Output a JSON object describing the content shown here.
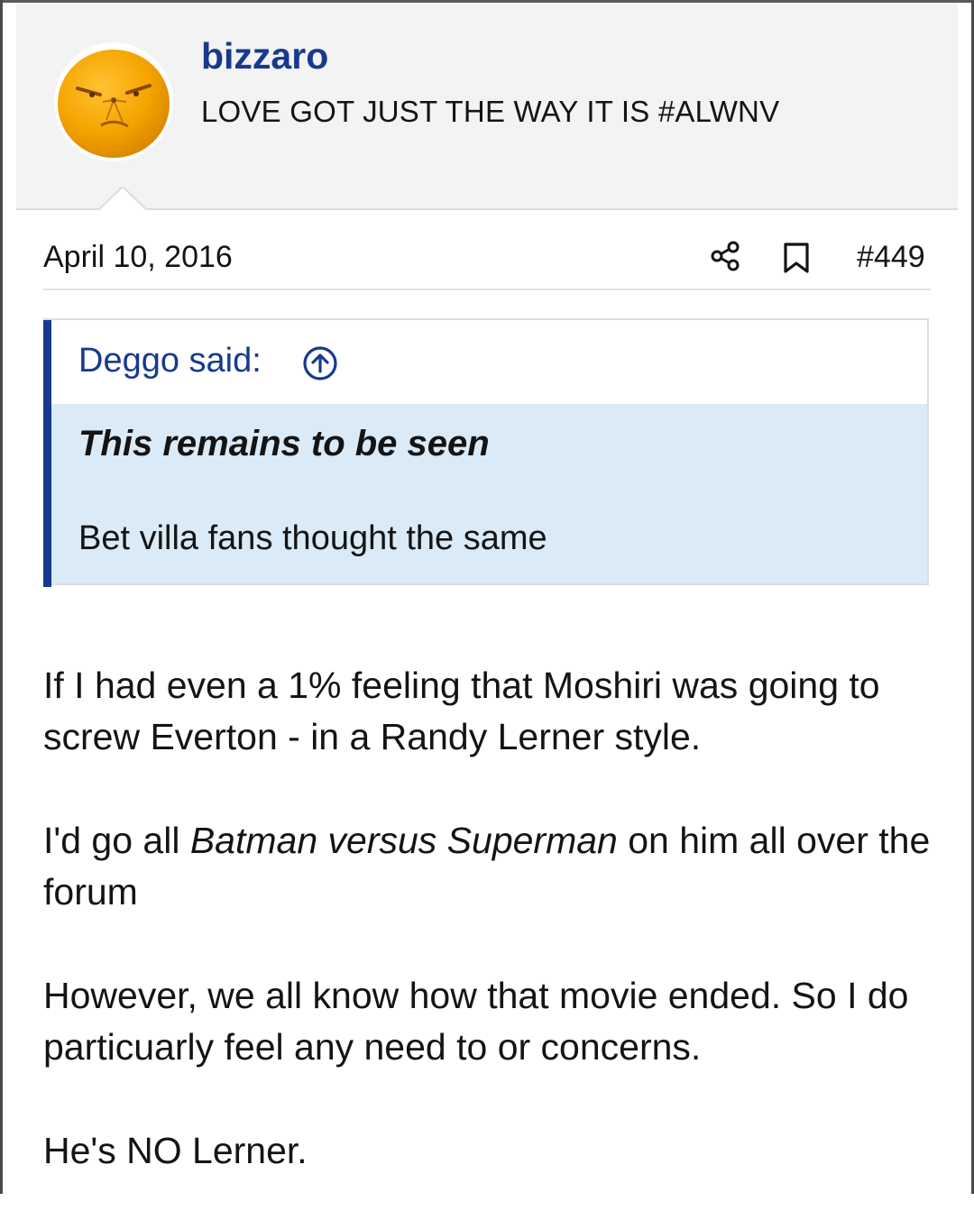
{
  "user": {
    "name": "bizzaro",
    "title": "LOVE GOT JUST THE WAY IT IS #ALWNV",
    "avatar_icon": "orange-face-avatar"
  },
  "post": {
    "date": "April 10, 2016",
    "number": "#449",
    "share_icon": "share-icon",
    "bookmark_icon": "bookmark-icon"
  },
  "quote": {
    "author": "Deggo said:",
    "jump_icon": "arrow-up-circle-icon",
    "emphasis": "This remains to be seen",
    "reply": "Bet villa fans thought the same"
  },
  "body": {
    "p1": "If I had even a 1% feeling that Moshiri was going to screw Everton - in a Randy Lerner style.",
    "p2_before": "I'd go all ",
    "p2_italic": "Batman versus Superman",
    "p2_after": " on him all over the forum",
    "p3": "However, we all know how that movie ended. So I do particuarly feel any need to or concerns.",
    "p4": "He's NO Lerner."
  },
  "colors": {
    "accent": "#173a8f",
    "quote_background": "#daeaf7",
    "header_background": "#f3f3f3"
  }
}
